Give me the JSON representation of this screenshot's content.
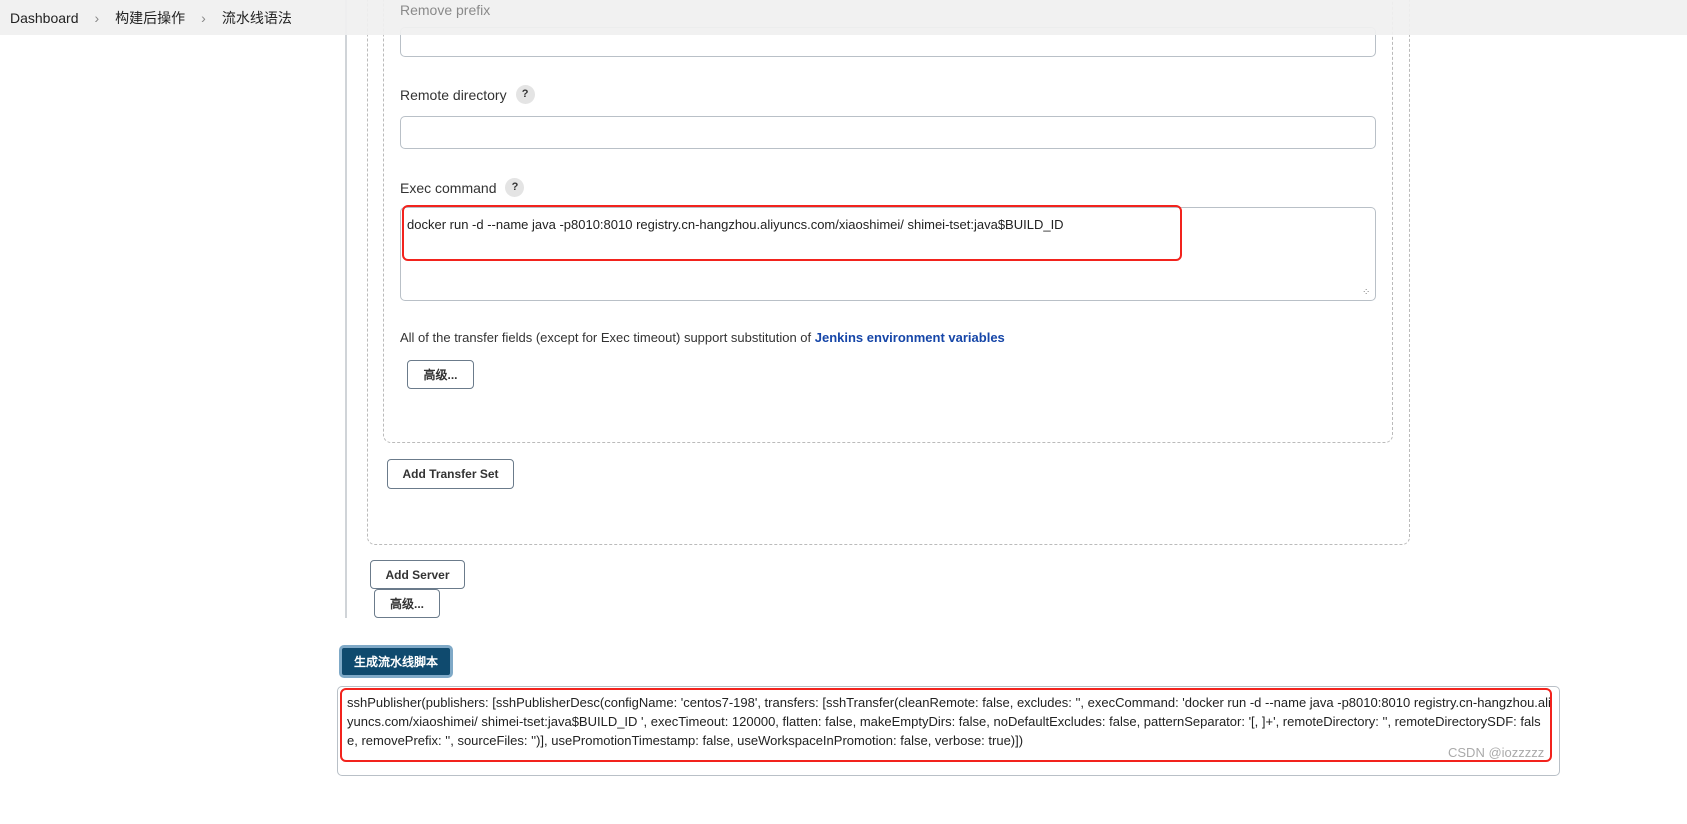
{
  "breadcrumb": [
    "Dashboard",
    "构建后操作",
    "流水线语法"
  ],
  "form": {
    "remove_prefix_label": "Remove prefix",
    "remove_prefix_value": "",
    "remote_directory_label": "Remote directory",
    "remote_directory_value": "",
    "exec_command_label": "Exec command",
    "exec_command_value": "docker run -d --name java -p8010:8010  registry.cn-hangzhou.aliyuncs.com/xiaoshimei/  shimei-tset:java$BUILD_ID",
    "help_text": "All of the transfer fields (except for Exec timeout) support substitution of ",
    "help_link": "Jenkins environment variables",
    "help_icon": "?",
    "advanced_label": "高级...",
    "add_transfer_set": "Add Transfer Set",
    "add_server": "Add Server",
    "advanced_label2": "高级..."
  },
  "generate_button": "生成流水线脚本",
  "output": "sshPublisher(publishers: [sshPublisherDesc(configName: 'centos7-198', transfers: [sshTransfer(cleanRemote: false, excludes: '', execCommand: 'docker run -d --name java -p8010:8010  registry.cn-hangzhou.aliyuncs.com/xiaoshimei/  shimei-tset:java$BUILD_ID ', execTimeout: 120000, flatten: false, makeEmptyDirs: false, noDefaultExcludes: false, patternSeparator: '[, ]+', remoteDirectory: '', remoteDirectorySDF: false, removePrefix: '', sourceFiles: '')], usePromotionTimestamp: false, useWorkspaceInPromotion: false, verbose: true)])",
  "watermark": "CSDN @iozzzzz",
  "colors": {
    "primary": "#0f4a6e",
    "highlight": "#f2231d",
    "link": "#1646a8"
  }
}
